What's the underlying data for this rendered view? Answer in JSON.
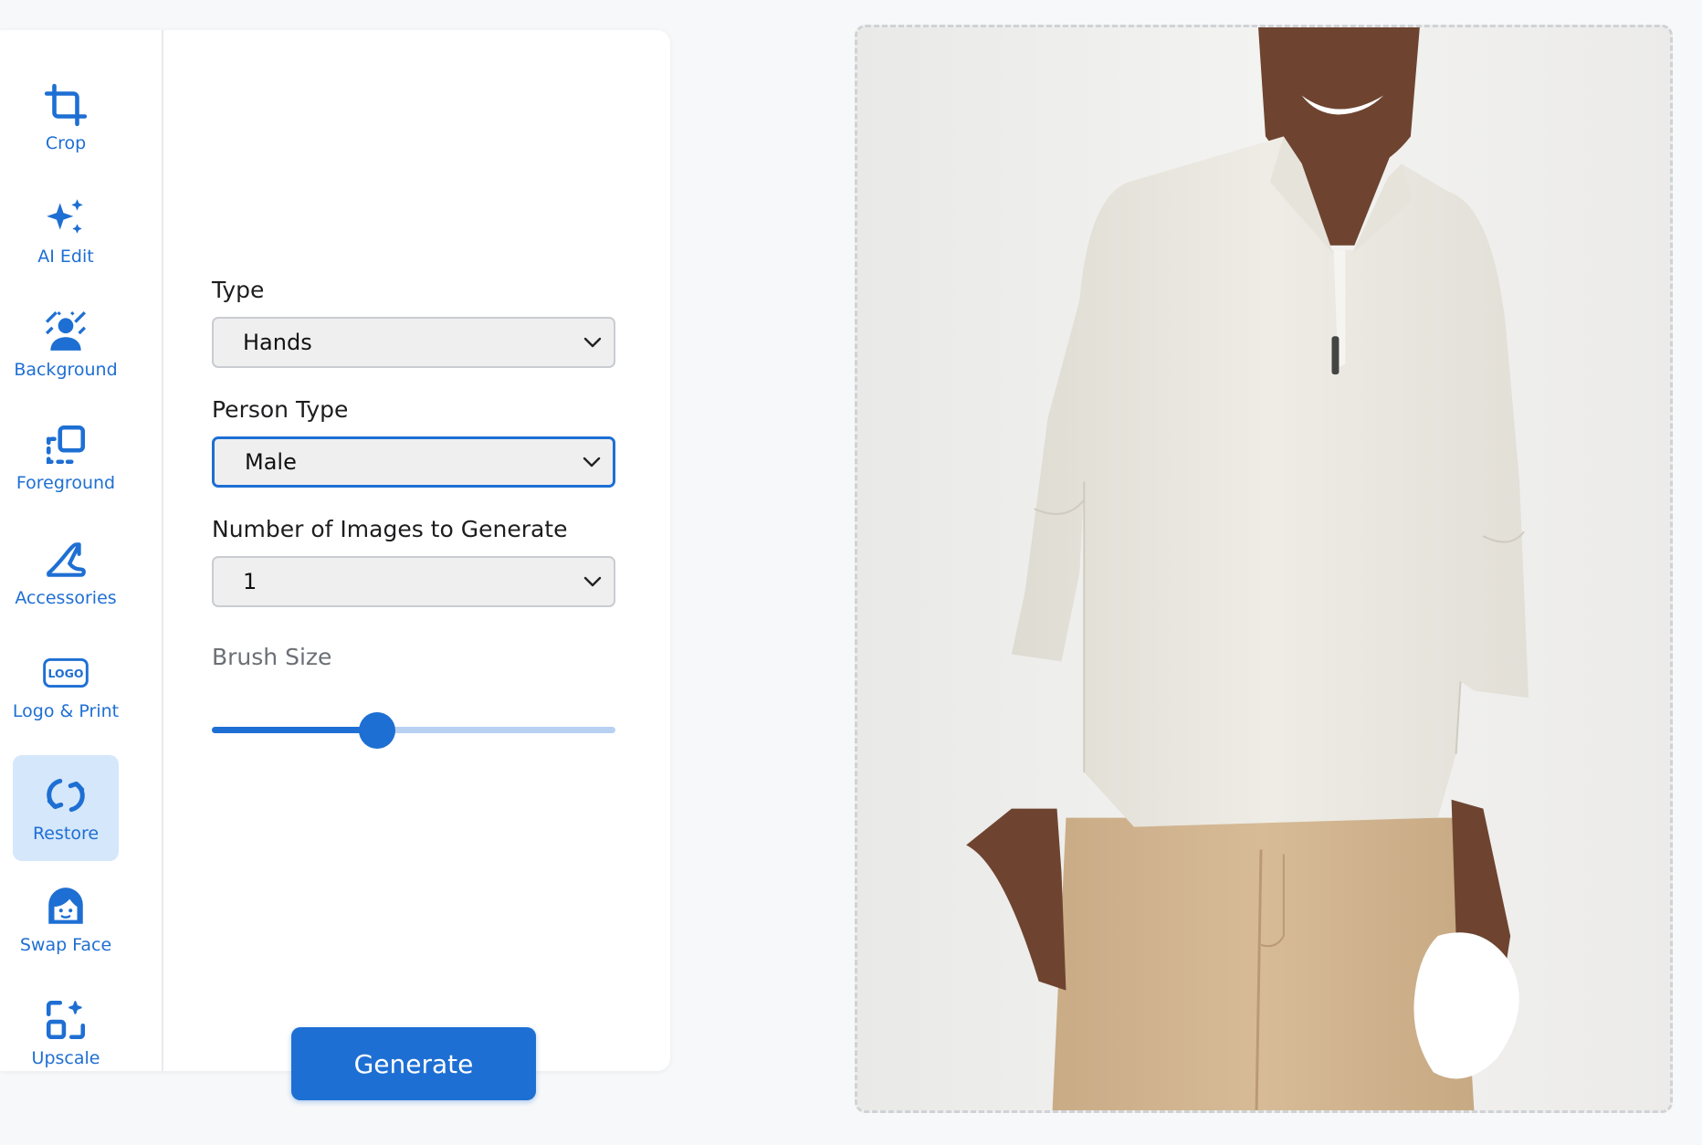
{
  "tools": [
    {
      "label": "Crop",
      "icon": "crop-icon",
      "active": false
    },
    {
      "label": "AI Edit",
      "icon": "sparkles-icon",
      "active": false
    },
    {
      "label": "Background",
      "icon": "background-person-icon",
      "active": false
    },
    {
      "label": "Foreground",
      "icon": "foreground-select-icon",
      "active": false
    },
    {
      "label": "Accessories",
      "icon": "high-heel-icon",
      "active": false
    },
    {
      "label": "Logo & Print",
      "icon": "logo-badge-icon",
      "active": false
    },
    {
      "label": "Restore",
      "icon": "restore-arrows-icon",
      "active": true
    },
    {
      "label": "Swap Face",
      "icon": "face-icon",
      "active": false
    },
    {
      "label": "Upscale",
      "icon": "upscale-icon",
      "active": false
    }
  ],
  "logo_badge_text": "LOGO",
  "form": {
    "type_label": "Type",
    "type_value": "Hands",
    "person_type_label": "Person Type",
    "person_type_value": "Male",
    "num_images_label": "Number of Images to Generate",
    "num_images_value": "1",
    "brush_size_label": "Brush Size",
    "brush_size_fraction": 0.41
  },
  "generate_label": "Generate",
  "colors": {
    "accent": "#1e6fd3",
    "active_tool_bg": "#d5e7fb",
    "slider_track": "#b8d1f3"
  }
}
